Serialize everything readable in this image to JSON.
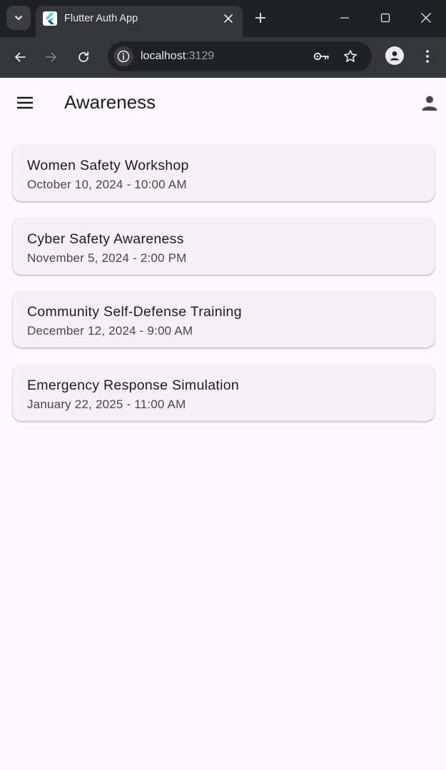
{
  "browser": {
    "tab_title": "Flutter Auth App",
    "url_host": "localhost",
    "url_port": ":3129",
    "icons": {
      "tab_search": "chevron-down-icon",
      "favicon": "flutter-logo-icon",
      "tab_close": "close-icon",
      "new_tab": "plus-icon",
      "minimize": "minimize-icon",
      "maximize": "maximize-icon",
      "close_window": "close-icon",
      "back": "arrow-left-icon",
      "forward": "arrow-right-icon",
      "reload": "reload-icon",
      "site_info": "info-icon",
      "password": "key-icon",
      "bookmark": "star-icon",
      "profile": "person-icon",
      "menu": "more-vert-icon"
    }
  },
  "app": {
    "title": "Awareness",
    "icons": {
      "drawer": "menu-icon",
      "account": "person-icon"
    },
    "events": [
      {
        "title": "Women Safety Workshop",
        "date": "October 10, 2024 - 10:00 AM"
      },
      {
        "title": "Cyber Safety Awareness",
        "date": "November 5, 2024 - 2:00 PM"
      },
      {
        "title": "Community Self-Defense Training",
        "date": "December 12, 2024 - 9:00 AM"
      },
      {
        "title": "Emergency Response Simulation",
        "date": "January 22, 2025 - 11:00 AM"
      }
    ]
  },
  "colors": {
    "chrome_dark": "#202124",
    "chrome_toolbar": "#35363a",
    "app_background": "#fdf7fe",
    "card_background": "#f6f1f7",
    "title_text": "#1d1b20",
    "secondary_text": "#49454f"
  }
}
